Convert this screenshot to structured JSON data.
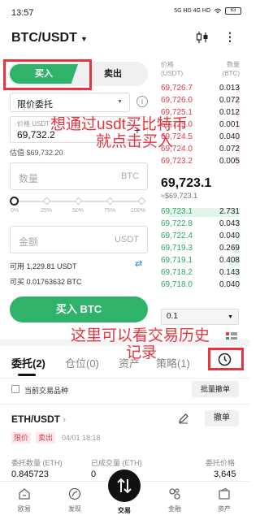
{
  "status_bar": {
    "time": "13:57",
    "network": "5G HD 4G HD",
    "battery": "63"
  },
  "header": {
    "pair": "BTC/USDT"
  },
  "trade": {
    "buy_tab": "买入",
    "sell_tab": "卖出",
    "order_type": "限价委托",
    "price_label": "价格 USDT",
    "price_value": "69,732.2",
    "est_value": "估值 $69,732.20",
    "quantity_placeholder": "数量",
    "quantity_unit": "BTC",
    "slider_ticks": [
      "0%",
      "25%",
      "50%",
      "75%",
      "100%"
    ],
    "slider_percent": 0,
    "amount_placeholder": "金额",
    "amount_unit": "USDT",
    "available": "可用 1,229.81 USDT",
    "can_buy": "可买 0.01763632 BTC",
    "buy_button": "买入 BTC"
  },
  "orderbook": {
    "price_header": "价格\n(USDT)",
    "qty_header": "数量\n(BTC)",
    "asks": [
      {
        "price": "69,726.7",
        "qty": "0.013"
      },
      {
        "price": "69,726.0",
        "qty": "0.072"
      },
      {
        "price": "69,725.1",
        "qty": "0.012"
      },
      {
        "price": "69,725.0",
        "qty": "0.001"
      },
      {
        "price": "69,724.5",
        "qty": "0.040"
      },
      {
        "price": "69,724.0",
        "qty": "0.072"
      },
      {
        "price": "69,723.2",
        "qty": "0.005"
      }
    ],
    "mid_price": "69,723.1",
    "mid_fiat": "≈$69,723.1",
    "bids": [
      {
        "price": "69,723.1",
        "qty": "2.731"
      },
      {
        "price": "69,722.8",
        "qty": "0.043"
      },
      {
        "price": "69,722.4",
        "qty": "0.040"
      },
      {
        "price": "69,719.3",
        "qty": "0.269"
      },
      {
        "price": "69,719.1",
        "qty": "0.408"
      },
      {
        "price": "69,718.2",
        "qty": "0.143"
      },
      {
        "price": "69,718.0",
        "qty": "0.040"
      }
    ],
    "precision": "0.1"
  },
  "annotations": {
    "note1_line1": "想通过usdt买比特币",
    "note1_line2": "就点击买入",
    "note2_line1": "这里可以看交易历史",
    "note2_line2": "记录"
  },
  "orders": {
    "tabs": [
      "委托(2)",
      "仓位(0)",
      "资产",
      "策略(1)"
    ],
    "filter_label": "当前交易品种",
    "batch_cancel": "批量撤单",
    "pair": "ETH/USDT",
    "cancel": "撤单",
    "badge_limit": "限价",
    "badge_side": "卖出",
    "date": "04/01 18:18",
    "fields": [
      {
        "label": "委托数量 (ETH)",
        "value": "0.845723"
      },
      {
        "label": "已成交量 (ETH)",
        "value": "0"
      },
      {
        "label": "委托价格",
        "value": "3,645"
      }
    ]
  },
  "nav": {
    "items": [
      "欧易",
      "发现",
      "交易",
      "金融",
      "资产"
    ]
  },
  "colors": {
    "buy": "#2fb36a",
    "sell": "#d9404f",
    "annotation": "#e8343e"
  }
}
